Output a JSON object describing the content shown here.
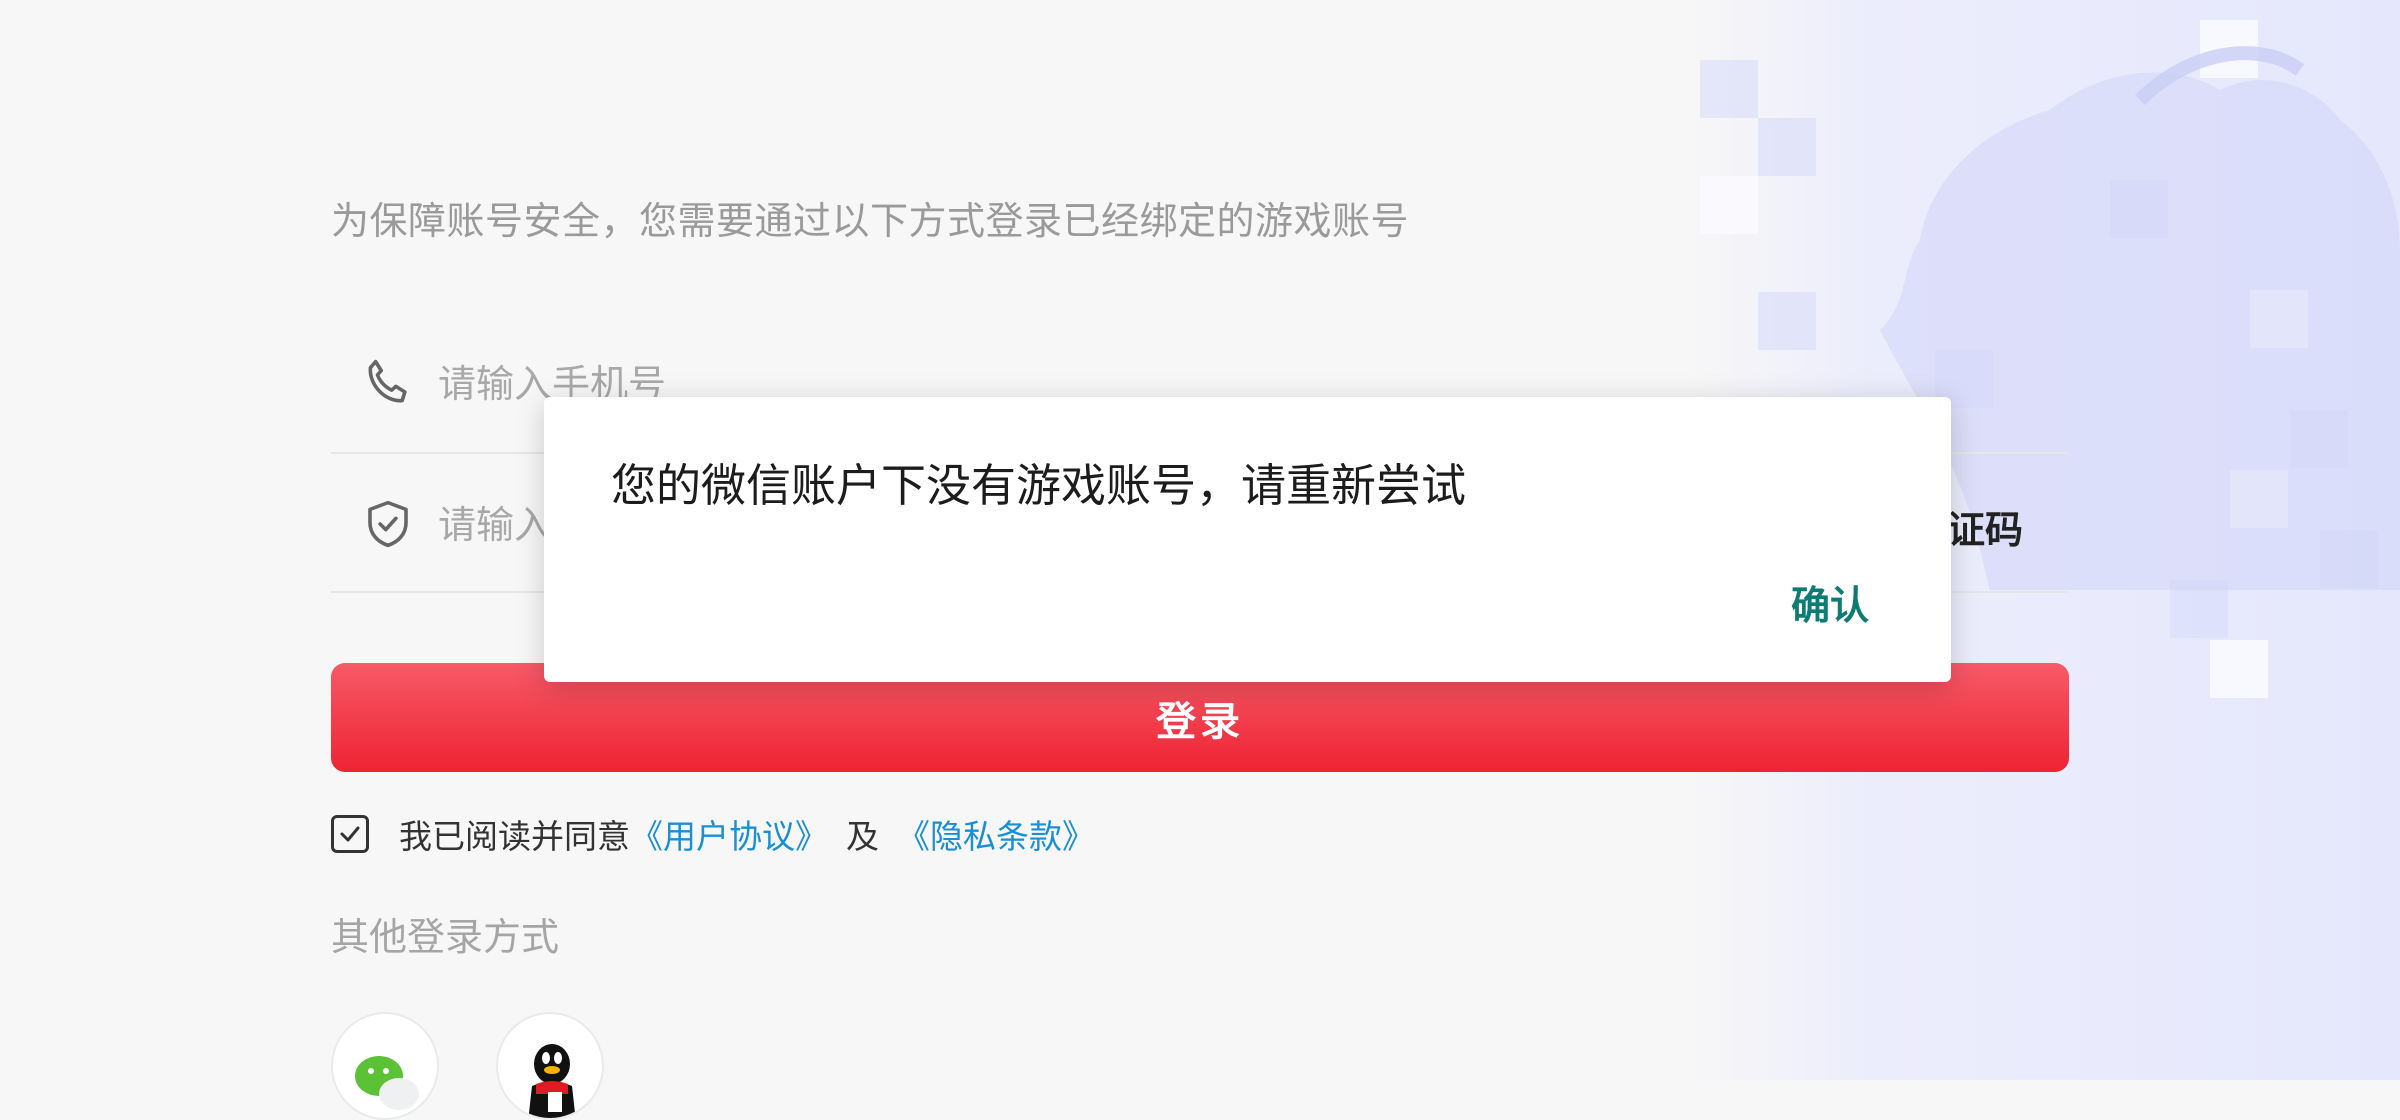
{
  "header": {
    "subtitle": "为保障账号安全，您需要通过以下方式登录已经绑定的游戏账号"
  },
  "form": {
    "phone": {
      "placeholder": "请输入手机号",
      "icon": "phone-icon"
    },
    "code": {
      "placeholder": "请输入",
      "icon": "shield-check-icon",
      "get_code_label": "证码"
    },
    "login_label": "登录"
  },
  "agreement": {
    "checked": true,
    "prefix": "我已阅读并同意",
    "user_agreement": "《用户协议》",
    "and": "及",
    "privacy_policy": "《隐私条款》"
  },
  "other_login": {
    "title": "其他登录方式",
    "options": [
      {
        "name": "wechat",
        "icon": "wechat-icon"
      },
      {
        "name": "qq",
        "icon": "qq-icon"
      }
    ]
  },
  "dialog": {
    "message": "您的微信账户下没有游戏账号，请重新尝试",
    "confirm_label": "确认"
  },
  "colors": {
    "primary_red": "#ee2333",
    "link_blue": "#1a8fd6",
    "confirm_teal": "#0f7c74"
  }
}
